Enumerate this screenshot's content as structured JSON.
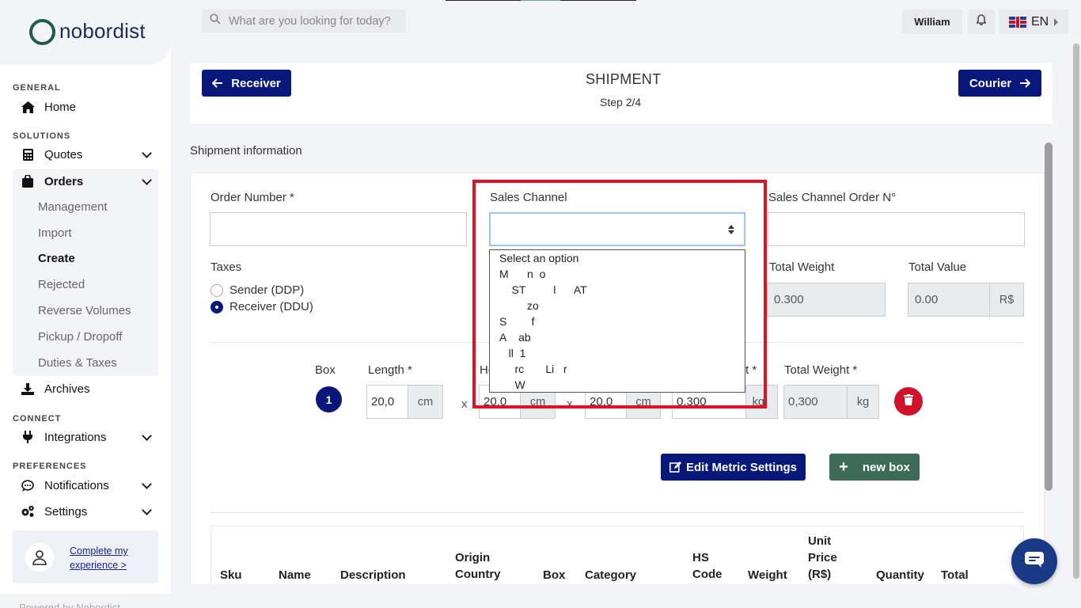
{
  "brand": {
    "name": "nobordist"
  },
  "search": {
    "placeholder": "What are you looking for today?"
  },
  "header": {
    "user": "William",
    "language": "EN"
  },
  "sidebar": {
    "sections": {
      "general": "GENERAL",
      "solutions": "SOLUTIONS",
      "connect": "CONNECT",
      "preferences": "PREFERENCES"
    },
    "home": "Home",
    "quotes": "Quotes",
    "orders": "Orders",
    "orders_items": [
      "Management",
      "Import",
      "Create",
      "Rejected",
      "Reverse Volumes",
      "Pickup / Dropoff",
      "Duties & Taxes"
    ],
    "archives": "Archives",
    "integrations": "Integrations",
    "notifications": "Notifications",
    "settings": "Settings",
    "profile_link_1": "Complete my",
    "profile_link_2": "experience >",
    "powered": "Powered by Nobordist"
  },
  "step": {
    "back_label": "Receiver",
    "next_label": "Courier",
    "title": "SHIPMENT",
    "subtitle": "Step 2/4"
  },
  "shipment_info": "Shipment information",
  "form": {
    "order_number_label": "Order Number *",
    "order_number_value": "",
    "sales_channel_label": "Sales Channel",
    "sales_channel_order_label": "Sales Channel Order N°",
    "taxes_label": "Taxes",
    "tax_options": [
      "Sender (DDP)",
      "Receiver (DDU)"
    ],
    "tax_selected": "Receiver (DDU)",
    "total_weight_label": "Total Weight",
    "total_weight_value": "0.300",
    "total_value_label": "Total Value",
    "total_value_value": "0.00",
    "currency": "R$"
  },
  "box": {
    "label": "Box",
    "number": "1",
    "length_label": "Length *",
    "height_label_partial": "He",
    "weight_label_partial": "t *",
    "total_weight_label": "Total Weight *",
    "length_value": "20,0",
    "height_value": "20,0",
    "width_value": "20,0",
    "weight_value": "0,300",
    "total_weight_value": "0,300",
    "unit_cm": "cm",
    "unit_kg": "kg",
    "unit_kg_partial": "kg",
    "times": "x"
  },
  "actions": {
    "edit_metric": "Edit Metric Settings",
    "new_box": "new box"
  },
  "table": {
    "headers": [
      "Sku",
      "Name",
      "Description",
      "Origin\nCountry",
      "Box",
      "Category",
      "HS\nCode",
      "Weight",
      "Unit\nPrice\n(R$)",
      "Quantity",
      "Total"
    ]
  },
  "dropdown": {
    "options": [
      "Select an option",
      "M      n  o",
      "    ST         l      AT",
      "         zo",
      "S        f",
      "A    ab",
      "   ll  1",
      "     rc       Li   r",
      "     W"
    ]
  },
  "colors": {
    "primary": "#08177a",
    "danger": "#d0132a",
    "green": "#3d6b57",
    "highlight": "#e01025"
  }
}
